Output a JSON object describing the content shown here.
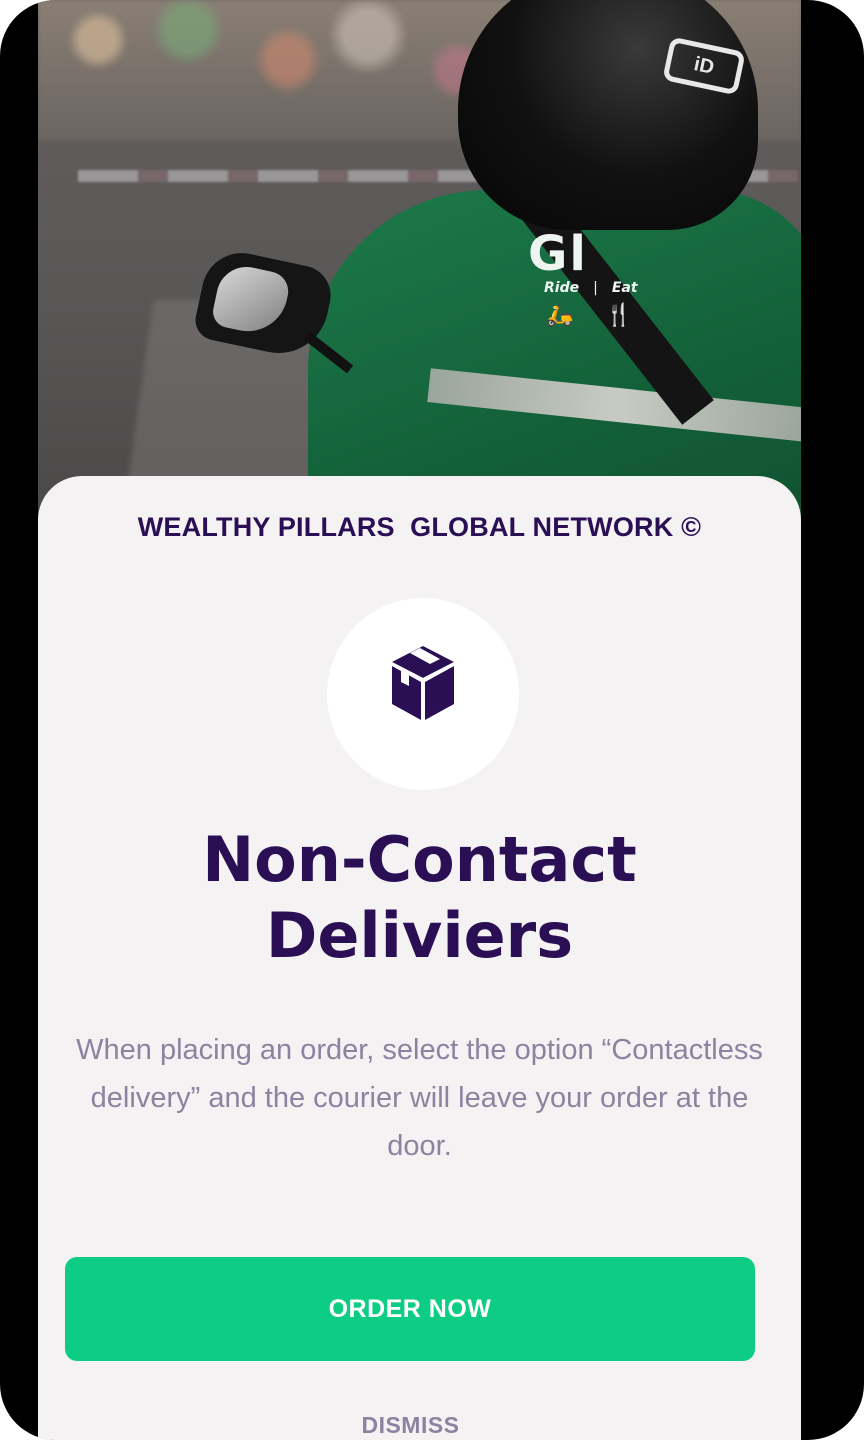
{
  "hero": {
    "image": "courier-on-motorbike-photo",
    "helmet_logo": "iD",
    "jacket_brand": "Gl",
    "jacket_sub_ride": "Ride",
    "jacket_sub_eat": "Eat",
    "jacket_separator": "|",
    "jacket_glyph_ride": "🛵",
    "jacket_glyph_eat": "🍴"
  },
  "sheet": {
    "brand_title": "WEALTHY PILLARS  GLOBAL NETWORK ©",
    "icon": "package-box-icon",
    "headline_line1": "Non-Contact",
    "headline_line2": "Deliviers",
    "description": "When placing an order, select the option “Contactless delivery” and the courier will leave your order at the door.",
    "primary_button": "ORDER NOW",
    "secondary_button": "DISMISS"
  },
  "colors": {
    "brand_dark": "#2a0f55",
    "accent_green": "#0ccd83",
    "muted_text": "#8b84a0",
    "sheet_bg": "#f4f2f3",
    "frame": "#000000"
  }
}
